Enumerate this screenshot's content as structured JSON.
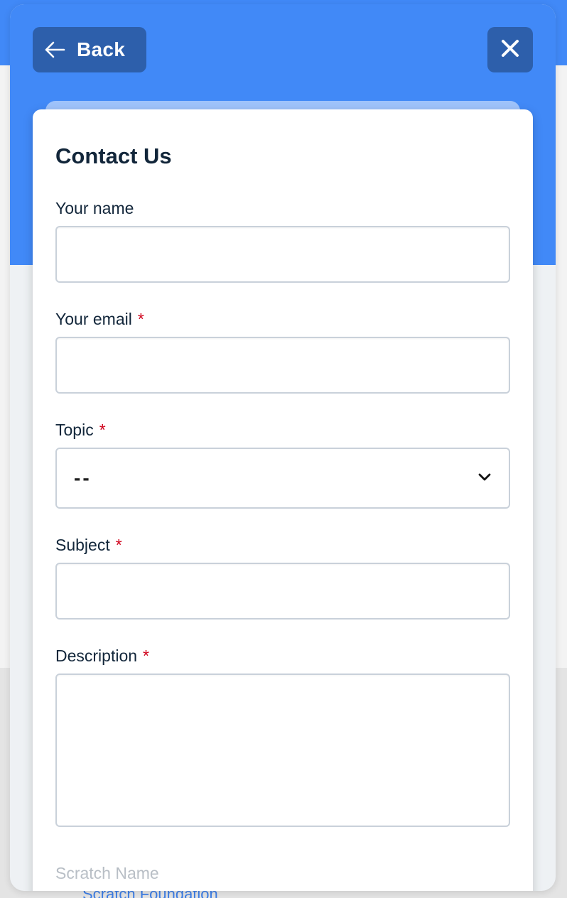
{
  "background": {
    "link_text": "Scratch Foundation",
    "colors": {
      "header_blue": "#4189f7",
      "button_dark_blue": "#2d5fab",
      "required_red": "#d0021b",
      "text_dark": "#12263a"
    }
  },
  "header": {
    "back_label": "Back",
    "back_icon": "arrow-left-icon",
    "close_icon": "close-icon"
  },
  "form": {
    "title": "Contact Us",
    "required_marker": "*",
    "fields": {
      "name": {
        "label": "Your name",
        "value": ""
      },
      "email": {
        "label": "Your email",
        "value": ""
      },
      "topic": {
        "label": "Topic",
        "selected": "--"
      },
      "subject": {
        "label": "Subject",
        "value": ""
      },
      "description": {
        "label": "Description",
        "value": ""
      },
      "scratch_name": {
        "label": "Scratch Name"
      }
    }
  }
}
